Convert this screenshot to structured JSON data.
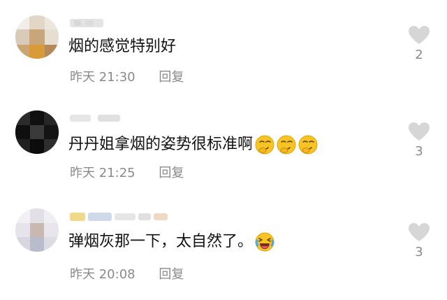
{
  "comments": [
    {
      "text": "烟的感觉特别好",
      "time": "昨天 21:30",
      "reply_label": "回复",
      "like_count": "2",
      "emojis": []
    },
    {
      "text": "丹丹姐拿烟的姿势很标准啊",
      "time": "昨天 21:25",
      "reply_label": "回复",
      "like_count": "3",
      "emojis": [
        "smirk-face-emoji",
        "smirk-face-emoji",
        "smirk-face-emoji"
      ]
    },
    {
      "text": "弹烟灰那一下，太自然了。",
      "time": "昨天 20:08",
      "reply_label": "回复",
      "like_count": "3",
      "emojis": [
        "laughing-crying-face-emoji"
      ]
    }
  ],
  "colors": {
    "meta_gray": "#8a8a8a",
    "heart_gray": "#d6d6d6",
    "text": "#111111",
    "emoji_yellow": "#f7c325"
  }
}
